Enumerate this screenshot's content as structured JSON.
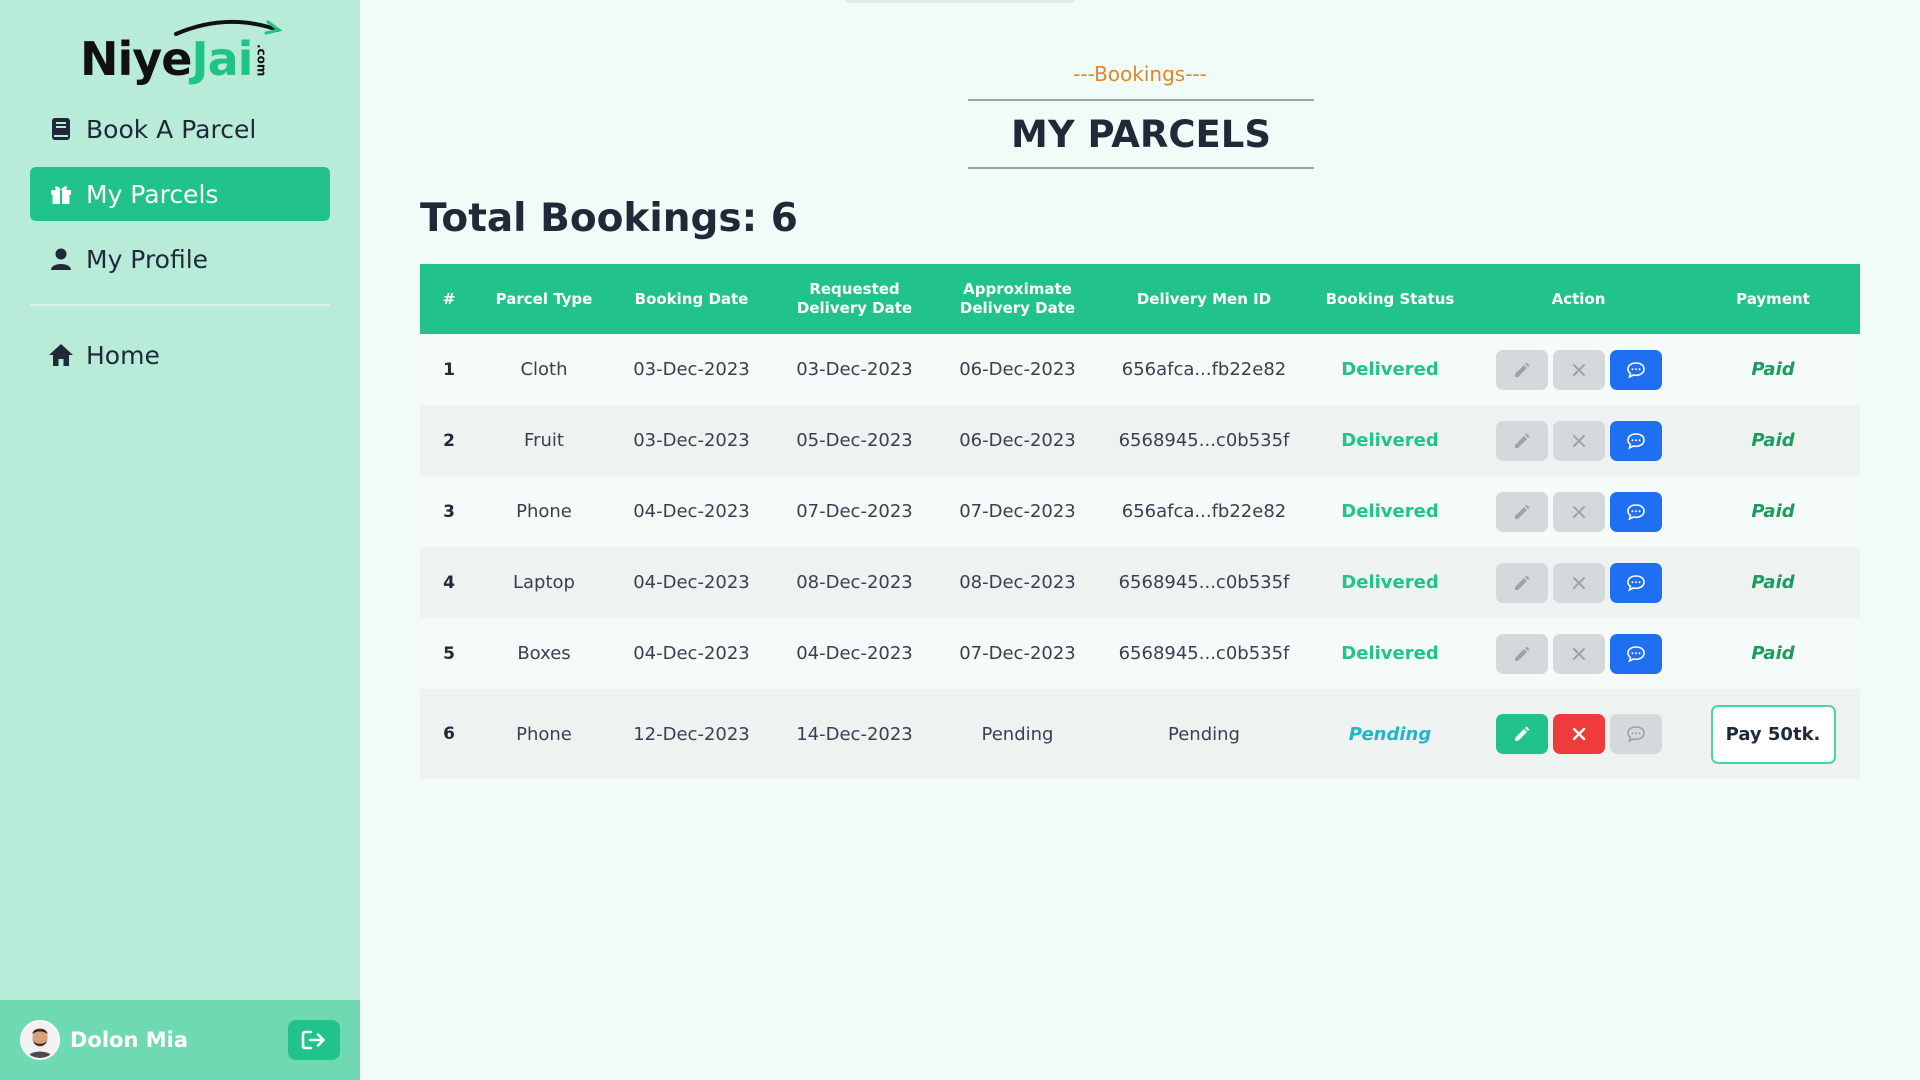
{
  "brand": {
    "name_part1": "Niye",
    "name_part2": "Jai",
    "suffix": ".com"
  },
  "sidebar": {
    "items": [
      {
        "label": "Book A Parcel",
        "icon": "book-icon",
        "active": false
      },
      {
        "label": "My Parcels",
        "icon": "gift-box-icon",
        "active": true
      },
      {
        "label": "My Profile",
        "icon": "user-icon",
        "active": false
      }
    ],
    "secondary": [
      {
        "label": "Home",
        "icon": "home-icon"
      }
    ],
    "user": {
      "name": "Dolon Mia"
    }
  },
  "page": {
    "subheading": "---Bookings---",
    "heading": "MY PARCELS",
    "total_label": "Total Bookings: 6"
  },
  "table": {
    "headers": {
      "num": "#",
      "parcel_type": "Parcel Type",
      "booking_date": "Booking Date",
      "requested_date": "Requested Delivery Date",
      "approx_date": "Approximate Delivery Date",
      "delivery_men_id": "Delivery Men ID",
      "booking_status": "Booking Status",
      "action": "Action",
      "payment": "Payment"
    },
    "rows": [
      {
        "num": "1",
        "type": "Cloth",
        "booking": "03-Dec-2023",
        "requested": "03-Dec-2023",
        "approx": "06-Dec-2023",
        "dm_id": "656afca...fb22e82",
        "status": "Delivered",
        "payment": "Paid"
      },
      {
        "num": "2",
        "type": "Fruit",
        "booking": "03-Dec-2023",
        "requested": "05-Dec-2023",
        "approx": "06-Dec-2023",
        "dm_id": "6568945...c0b535f",
        "status": "Delivered",
        "payment": "Paid"
      },
      {
        "num": "3",
        "type": "Phone",
        "booking": "04-Dec-2023",
        "requested": "07-Dec-2023",
        "approx": "07-Dec-2023",
        "dm_id": "656afca...fb22e82",
        "status": "Delivered",
        "payment": "Paid"
      },
      {
        "num": "4",
        "type": "Laptop",
        "booking": "04-Dec-2023",
        "requested": "08-Dec-2023",
        "approx": "08-Dec-2023",
        "dm_id": "6568945...c0b535f",
        "status": "Delivered",
        "payment": "Paid"
      },
      {
        "num": "5",
        "type": "Boxes",
        "booking": "04-Dec-2023",
        "requested": "04-Dec-2023",
        "approx": "07-Dec-2023",
        "dm_id": "6568945...c0b535f",
        "status": "Delivered",
        "payment": "Paid"
      },
      {
        "num": "6",
        "type": "Phone",
        "booking": "12-Dec-2023",
        "requested": "14-Dec-2023",
        "approx": "Pending",
        "dm_id": "Pending",
        "status": "Pending",
        "payment": "Pay 50tk."
      }
    ]
  },
  "colors": {
    "accent": "#22c38a",
    "sidebar_bg": "#b8ecd9",
    "page_bg": "#f1fbf7",
    "subheading": "#e0862a",
    "review_blue": "#1f6ff2",
    "cancel_red": "#ef3b3b",
    "pending": "#1fb6c9"
  }
}
